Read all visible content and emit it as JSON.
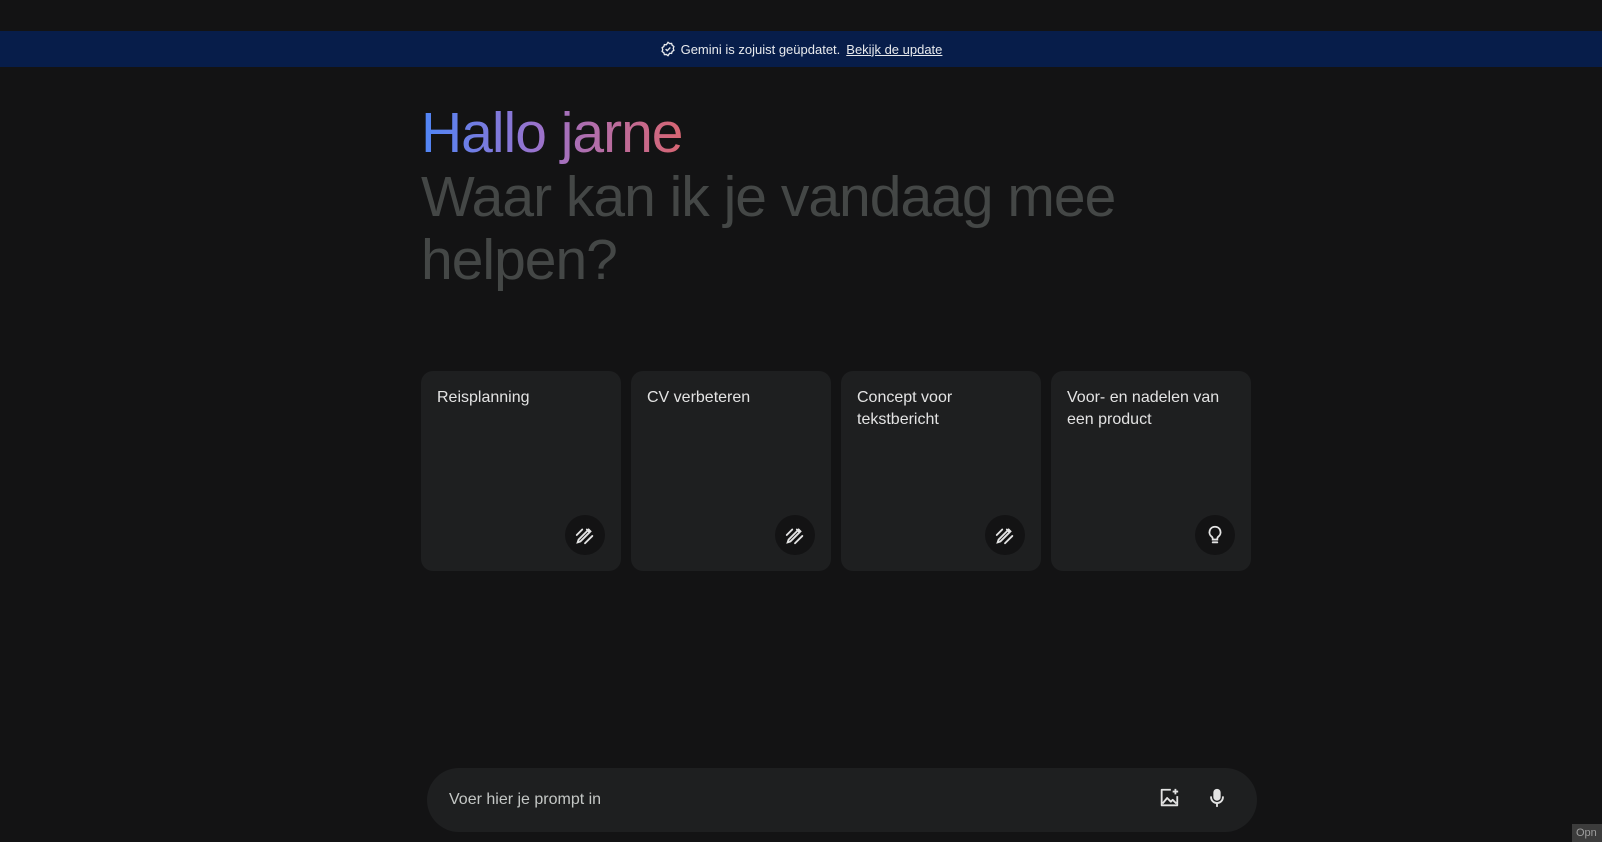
{
  "banner": {
    "text": "Gemini is zojuist geüpdatet.",
    "link": "Bekijk de update",
    "icon": "verified-check-icon",
    "background": "#071d4a"
  },
  "greeting": {
    "hello": "Hallo jarne",
    "subtitle": "Waar kan ik je vandaag mee helpen?"
  },
  "cards": [
    {
      "label": "Reisplanning",
      "icon": "draw-pencil-icon"
    },
    {
      "label": "CV verbeteren",
      "icon": "draw-pencil-icon"
    },
    {
      "label": "Concept voor tekstbericht",
      "icon": "draw-pencil-icon"
    },
    {
      "label": "Voor- en nadelen van een product",
      "icon": "lightbulb-icon"
    }
  ],
  "prompt": {
    "placeholder": "Voer hier je prompt in",
    "image_icon": "add-image-icon",
    "mic_icon": "microphone-icon"
  },
  "corner_tab": {
    "label": "Opn"
  },
  "colors": {
    "background": "#131314",
    "card": "#1e1f20",
    "gradient_start": "#4f86f7",
    "gradient_mid": "#9b72cb",
    "gradient_end": "#d96570",
    "subtitle": "#444746"
  }
}
